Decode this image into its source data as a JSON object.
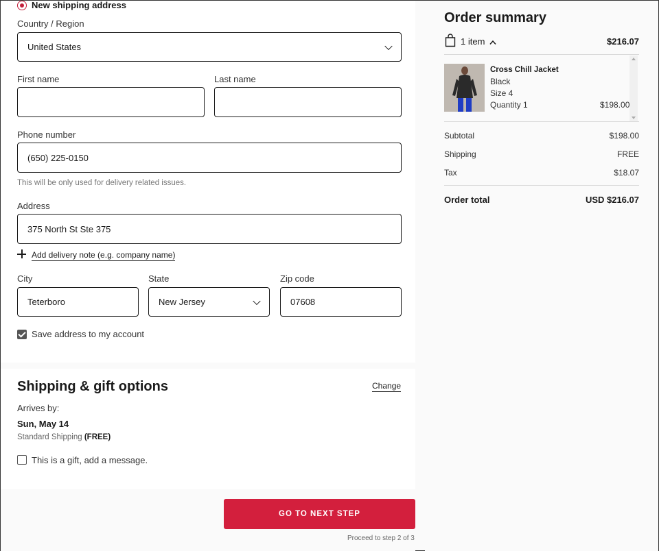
{
  "shipping": {
    "new_address_label": "New shipping address",
    "country_label": "Country / Region",
    "country_value": "United States",
    "first_name_label": "First name",
    "first_name_value": "",
    "last_name_label": "Last name",
    "last_name_value": "",
    "phone_label": "Phone number",
    "phone_value": "(650) 225-0150",
    "phone_hint": "This will be only used for delivery related issues.",
    "address_label": "Address",
    "address_value": "375 North St Ste 375",
    "add_note_link": "Add delivery note (e.g. company name)",
    "city_label": "City",
    "city_value": "Teterboro",
    "state_label": "State",
    "state_value": "New Jersey",
    "zip_label": "Zip code",
    "zip_value": "07608",
    "save_address_label": "Save address to my account",
    "save_address_checked": true
  },
  "options": {
    "title": "Shipping & gift options",
    "change_link": "Change",
    "arrives_label": "Arrives by:",
    "arrives_date": "Sun, May 14",
    "shipping_method": "Standard Shipping",
    "shipping_price": "(FREE)",
    "gift_label": "This is a gift, add a message.",
    "gift_checked": false
  },
  "footer": {
    "next_button": "GO TO NEXT STEP",
    "step_text": "Proceed to step 2 of 3"
  },
  "summary": {
    "title": "Order summary",
    "item_count": "1 item",
    "header_total": "$216.07",
    "product": {
      "name": "Cross Chill Jacket",
      "color": "Black",
      "size": "Size 4",
      "quantity": "Quantity 1",
      "price": "$198.00"
    },
    "subtotal_label": "Subtotal",
    "subtotal_value": "$198.00",
    "shipping_label": "Shipping",
    "shipping_value": "FREE",
    "tax_label": "Tax",
    "tax_value": "$18.07",
    "total_label": "Order total",
    "total_value": "USD $216.07"
  },
  "colors": {
    "accent": "#d31f3d",
    "radio": "#c41e3a"
  }
}
